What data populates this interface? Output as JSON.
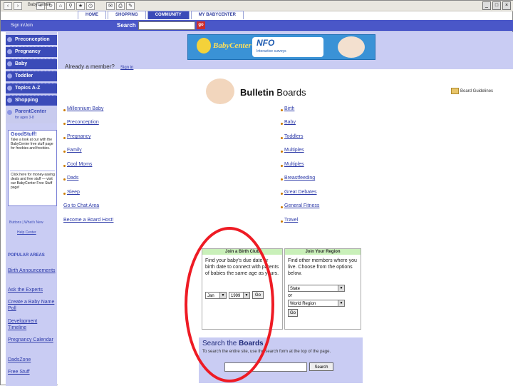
{
  "browser": {
    "toolbar_icons": [
      "back",
      "forward",
      "stop",
      "refresh",
      "home",
      "search",
      "favorites",
      "history",
      "mail",
      "print",
      "edit"
    ]
  },
  "site": {
    "logo_text": "BabyCenter",
    "tabs": [
      "HOME",
      "SHOPPING",
      "COMMUNITY",
      "MY BABYCENTER"
    ],
    "active_tab": "COMMUNITY"
  },
  "topbar": {
    "sign_text": "Sign in/Join",
    "search_label": "Search",
    "go_label": "go"
  },
  "sidebar": {
    "items": [
      {
        "label": "Preconception"
      },
      {
        "label": "Pregnancy"
      },
      {
        "label": "Baby"
      },
      {
        "label": "Toddler"
      },
      {
        "label": "Topics A-Z"
      },
      {
        "label": "Shopping"
      }
    ],
    "parentcenter": {
      "title": "ParentCenter",
      "subtitle": "for ages 3-8"
    },
    "goodstuff": {
      "title": "GoodStuff!",
      "text1": "Take a look at our with the BabyCenter free stuff page for freebies and freebies.",
      "text2": "Click here for money-saving deals and free stuff — visit our BabyCenter Free Stuff page!"
    },
    "help": {
      "line1": "Buttons | What's New",
      "line2": "Help Center"
    },
    "popular_title": "POPULAR AREAS",
    "popular": [
      "Birth Announcements",
      "Ask the Experts",
      "Create a Baby Name Poll",
      "Development Timeline",
      "Pregnancy Calendar",
      "DadsZone",
      "Free Stuff"
    ]
  },
  "banner": {
    "brand": "BabyCenter",
    "partner": "NFO",
    "tagline": "Interactive surveys"
  },
  "member": {
    "text": "Already a member?",
    "link": "Sign in"
  },
  "heading": {
    "bold": "Bulletin",
    "rest": "Boards"
  },
  "help_link": "Board Guidelines",
  "boards_left": [
    "Millennium Baby",
    "Preconception",
    "Pregnancy",
    "Family",
    "Cool Moms",
    "Dads",
    "Sleep"
  ],
  "boards_right": [
    "Birth",
    "Baby",
    "Toddlers",
    "Multiples",
    "Multiples",
    "Breastfeeding",
    "Great Debates",
    "General Fitness",
    "Travel"
  ],
  "chat": "Go to Chat Area",
  "host": "Become a Board Host!",
  "birthclub": {
    "header": "Join a Birth Club",
    "text": "Find your baby's due date or birth date to connect with parents of babies the same age as yours.",
    "month": "Jan",
    "year": "1999",
    "go": "Go"
  },
  "region": {
    "header": "Join Your Region",
    "text": "Find other members where you live. Choose from the options below.",
    "state": "State",
    "or": "or",
    "world": "World Region",
    "go": "Go"
  },
  "searchboards": {
    "title_plain": "Search the ",
    "title_bold": "Boards",
    "text": "To search the entire site, use the search form at the top of the page.",
    "button": "Search"
  }
}
